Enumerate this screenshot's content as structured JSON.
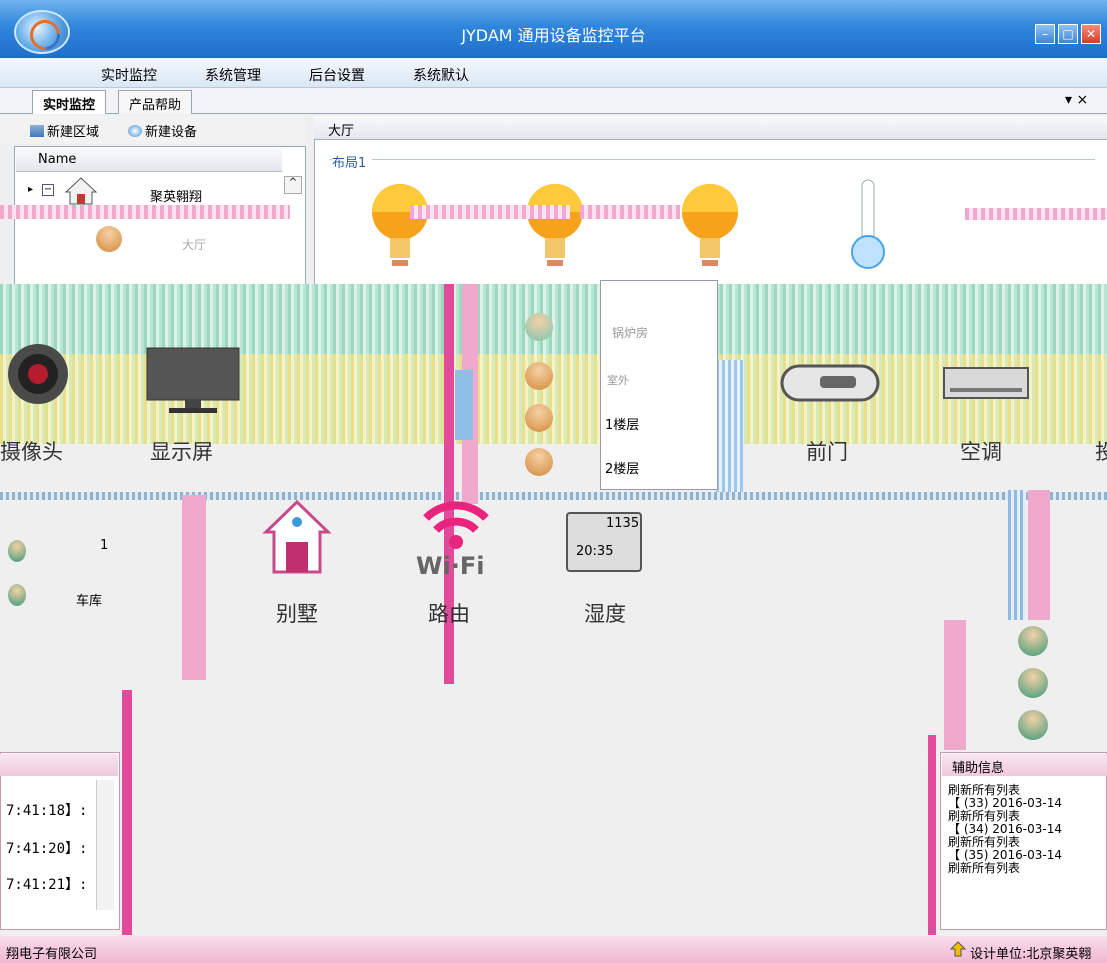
{
  "window": {
    "title": "JYDAM 通用设备监控平台",
    "btn_min": "–",
    "btn_max": "□",
    "btn_close": "✕"
  },
  "menu": [
    "实时监控",
    "系统管理",
    "后台设置",
    "系统默认"
  ],
  "tabs": {
    "active": "实时监控",
    "other": "产品帮助",
    "controls": "▾ ×"
  },
  "left_toolbar": {
    "new_area": "新建区域",
    "new_device": "新建设备"
  },
  "tree": {
    "header": "Name",
    "root": "聚英翱翔",
    "nodes": [
      "大厅",
      "锅炉房",
      "室外",
      "1楼层",
      "2楼层",
      "车库",
      "1"
    ]
  },
  "right": {
    "title": "大厅",
    "layout_label": "布局1"
  },
  "devices_row1": [
    "摄像头",
    "显示屏",
    "前门",
    "空调",
    "投"
  ],
  "devices_row2": [
    "别墅",
    "路由",
    "湿度"
  ],
  "wifi_text": "Wi·Fi",
  "humidity_display": {
    "top": "1135",
    "bottom": "20:35"
  },
  "log_times": [
    "7:41:18】:",
    "7:41:20】:",
    "7:41:21】:"
  ],
  "aux": {
    "title": "辅助信息",
    "lines": [
      "刷新所有列表",
      "【 (33) 2016-03-14",
      "刷新所有列表",
      "【 (34) 2016-03-14",
      "刷新所有列表",
      "【 (35) 2016-03-14",
      "刷新所有列表"
    ]
  },
  "status": {
    "left": "翔电子有限公司",
    "right": "设计单位:北京聚英翱"
  },
  "colors": {
    "title_blue": "#2f86dc",
    "accent_pink": "#e24a9c",
    "bulb_orange": "#f7a21b"
  }
}
